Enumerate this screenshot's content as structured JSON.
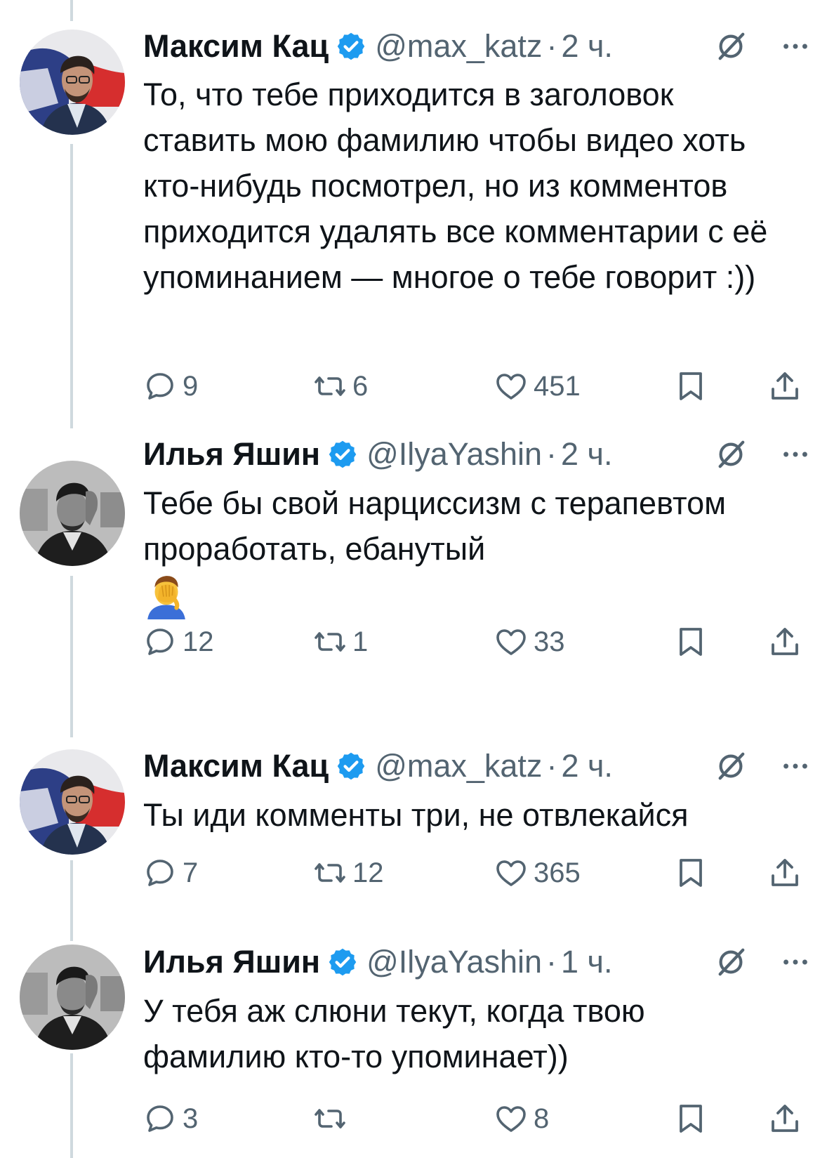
{
  "tweets": [
    {
      "name": "Максим Кац",
      "handle": "@max_katz",
      "separator": "·",
      "time": "2 ч.",
      "text": "То, что тебе приходится в заголовок ставить мою фамилию чтобы видео хоть кто-нибудь посмотрел, но из комментов приходится удалять все комментарии с её упоминанием — многое о тебе говорит :))",
      "replies": "9",
      "retweets": "6",
      "likes": "451",
      "avatar": "max-katz-avatar"
    },
    {
      "name": "Илья Яшин",
      "handle": "@IlyaYashin",
      "separator": "·",
      "time": "2 ч.",
      "text": "Тебе бы свой нарциссизм с терапевтом проработать, ебанутый",
      "emoji": "facepalm-emoji",
      "replies": "12",
      "retweets": "1",
      "likes": "33",
      "avatar": "ilya-yashin-avatar"
    },
    {
      "name": "Максим Кац",
      "handle": "@max_katz",
      "separator": "·",
      "time": "2 ч.",
      "text": "Ты иди комменты три, не отвлекайся",
      "replies": "7",
      "retweets": "12",
      "likes": "365",
      "avatar": "max-katz-avatar"
    },
    {
      "name": "Илья Яшин",
      "handle": "@IlyaYashin",
      "separator": "·",
      "time": "1 ч.",
      "text": "У тебя аж слюни текут, когда твою фамилию кто-то упоминает))",
      "replies": "3",
      "retweets": "",
      "likes": "8",
      "avatar": "ilya-yashin-avatar"
    }
  ],
  "colors": {
    "text": "#0f1419",
    "secondary": "#536471",
    "verified": "#1d9bf0",
    "thread_line": "#cfd9de"
  },
  "icons": {
    "verified": "verified-badge-icon",
    "grok": "grok-icon",
    "more": "more-icon",
    "reply": "reply-icon",
    "retweet": "retweet-icon",
    "like": "heart-icon",
    "bookmark": "bookmark-icon",
    "share": "share-icon"
  }
}
